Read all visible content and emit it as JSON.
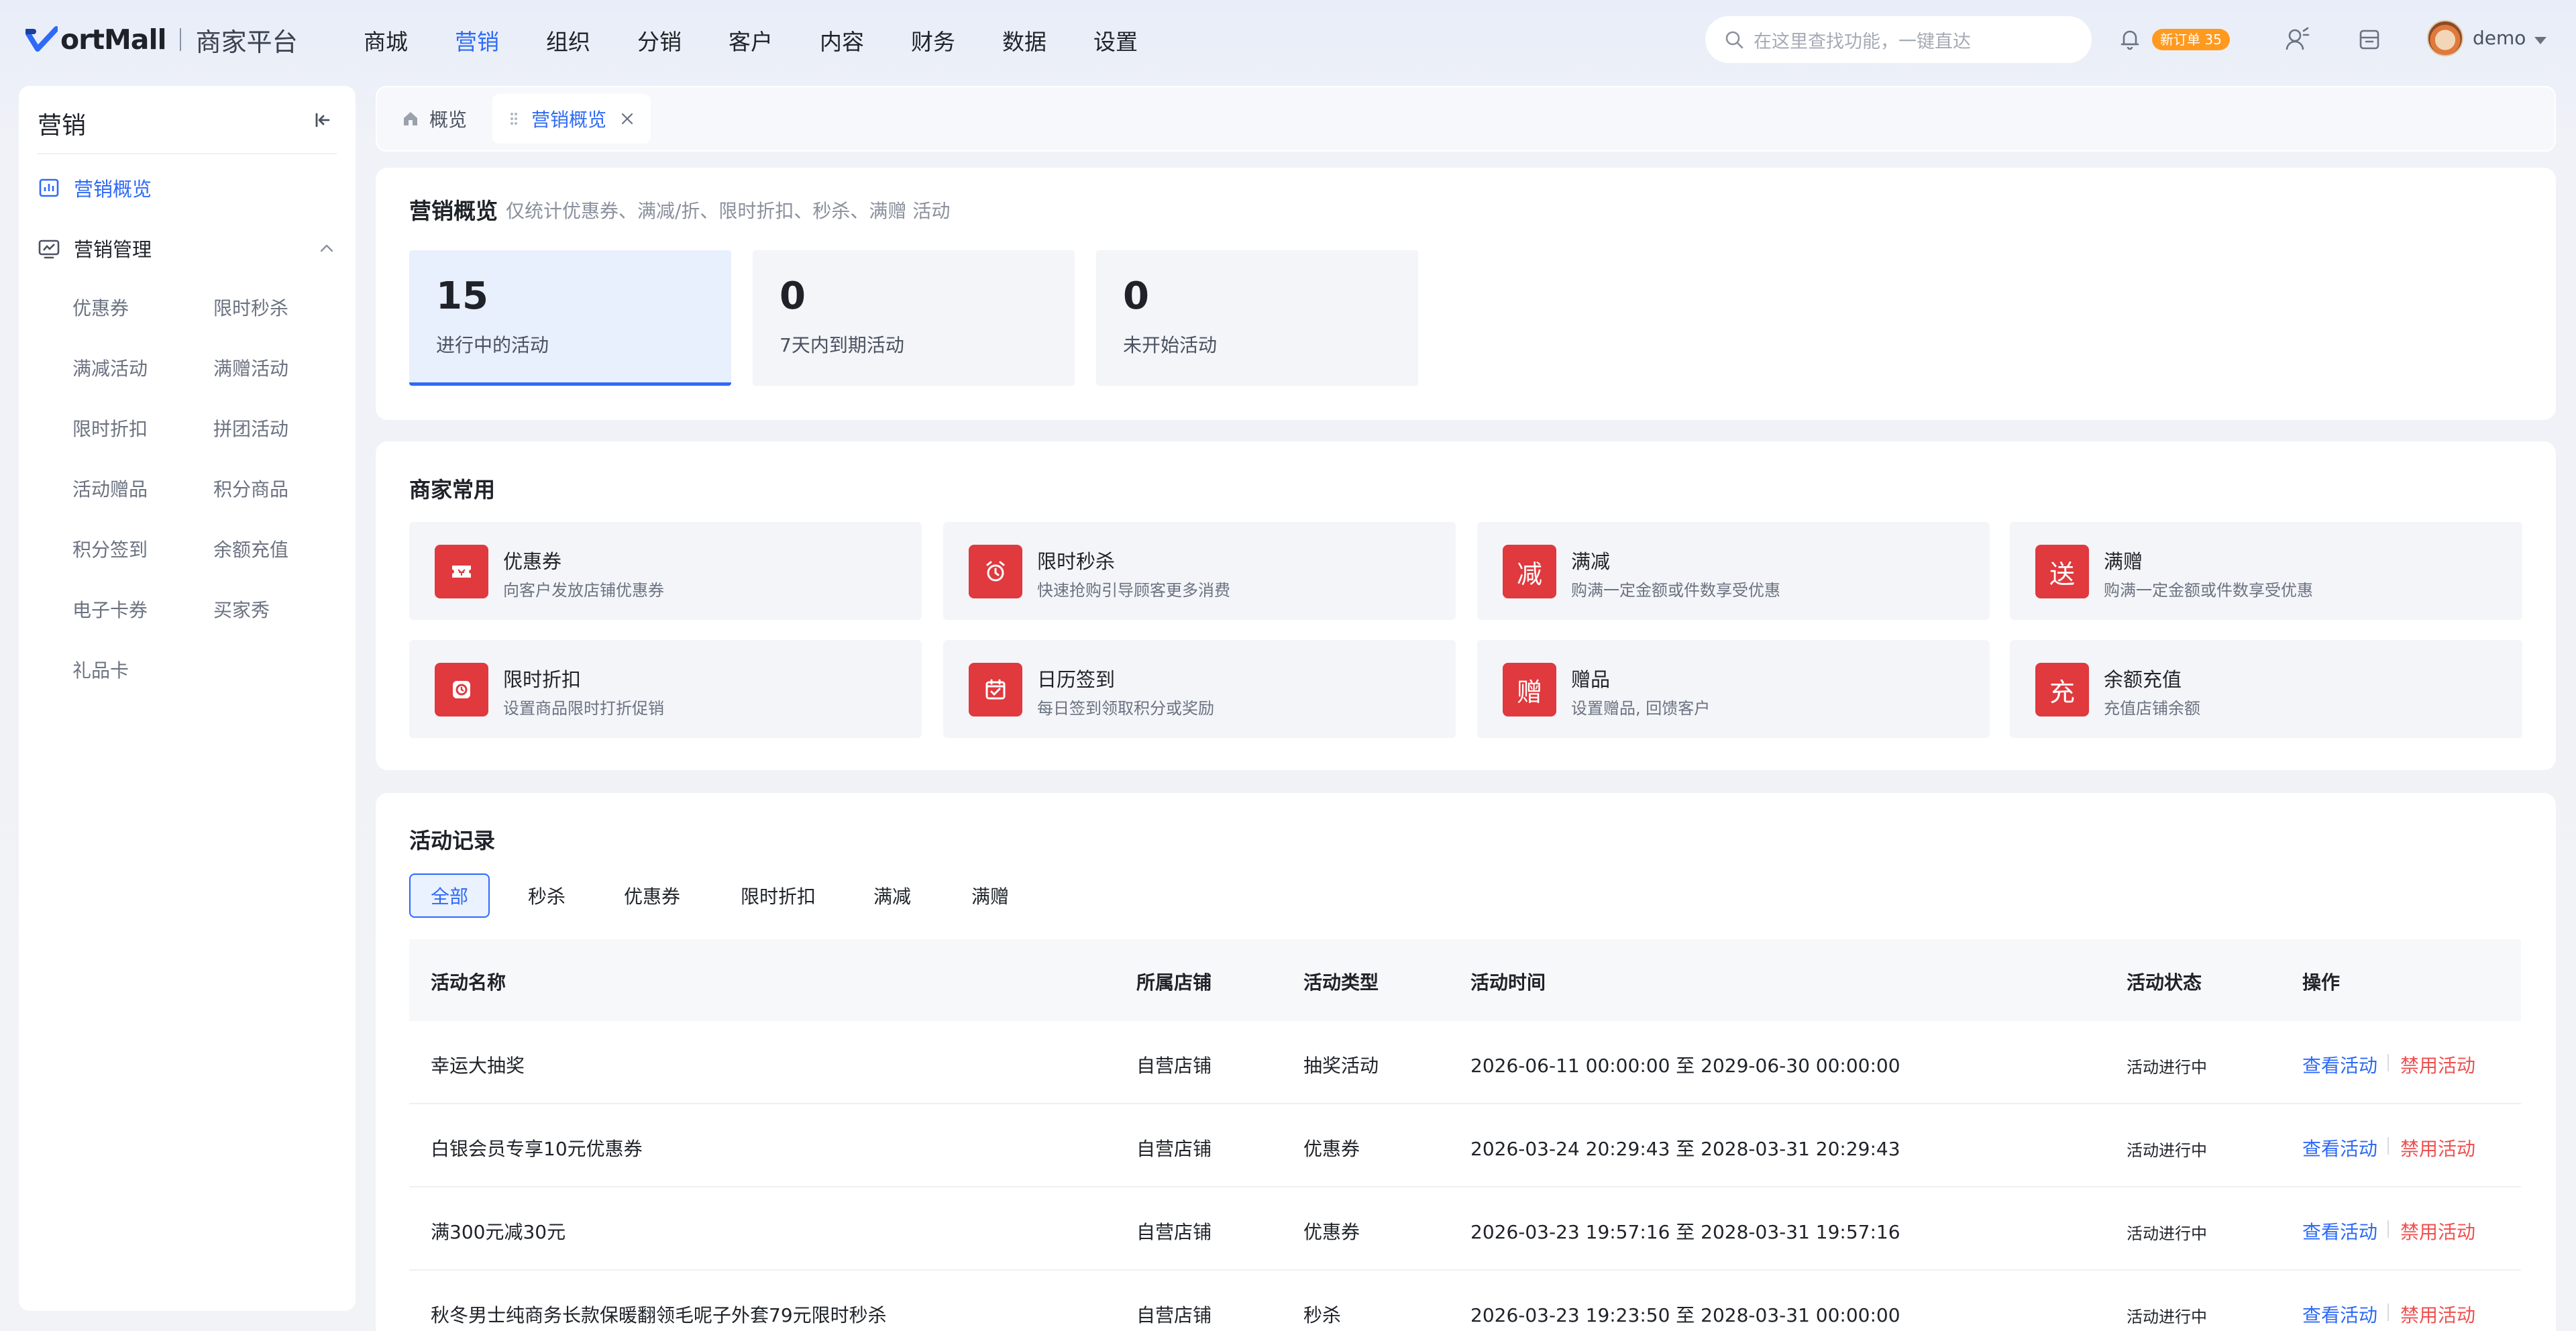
{
  "header": {
    "brand": "ortMall",
    "platform": "商家平台",
    "nav": [
      "商城",
      "营销",
      "组织",
      "分销",
      "客户",
      "内容",
      "财务",
      "数据",
      "设置"
    ],
    "active_nav": "营销",
    "search_placeholder": "在这里查找功能，一键直达",
    "order_badge": "新订单 35",
    "user": "demo",
    "accent": "#2e6af6"
  },
  "sidebar": {
    "title": "营销",
    "overview": "营销概览",
    "group": "营销管理",
    "items": [
      "优惠券",
      "限时秒杀",
      "满减活动",
      "满赠活动",
      "限时折扣",
      "拼团活动",
      "活动赠品",
      "积分商品",
      "积分签到",
      "余额充值",
      "电子卡券",
      "买家秀",
      "礼品卡"
    ]
  },
  "tabs": [
    {
      "label": "概览"
    },
    {
      "label": "营销概览"
    }
  ],
  "overview": {
    "title": "营销概览",
    "subtitle": "仅统计优惠券、满减/折、限时折扣、秒杀、满赠 活动",
    "stats": [
      {
        "value": "15",
        "label": "进行中的活动"
      },
      {
        "value": "0",
        "label": "7天内到期活动"
      },
      {
        "value": "0",
        "label": "未开始活动"
      }
    ]
  },
  "common": {
    "title": "商家常用",
    "tiles": [
      {
        "icon": "ticket-icon",
        "title": "优惠券",
        "desc": "向客户发放店铺优惠券"
      },
      {
        "icon": "alarm-clock-icon",
        "title": "限时秒杀",
        "desc": "快速抢购引导顾客更多消费"
      },
      {
        "icon": "jian-char-icon",
        "glyph": "减",
        "title": "满减",
        "desc": "购满一定金额或件数享受优惠"
      },
      {
        "icon": "song-char-icon",
        "glyph": "送",
        "title": "满赠",
        "desc": "购满一定金额或件数享受优惠"
      },
      {
        "icon": "timer-icon",
        "title": "限时折扣",
        "desc": "设置商品限时打折促销"
      },
      {
        "icon": "calendar-check-icon",
        "title": "日历签到",
        "desc": "每日签到领取积分或奖励"
      },
      {
        "icon": "zeng-char-icon",
        "glyph": "赠",
        "title": "赠品",
        "desc": "设置赠品, 回馈客户"
      },
      {
        "icon": "chong-char-icon",
        "glyph": "充",
        "title": "余额充值",
        "desc": "充值店铺余额"
      }
    ]
  },
  "records": {
    "title": "活动记录",
    "filters": [
      "全部",
      "秒杀",
      "优惠券",
      "限时折扣",
      "满减",
      "满赠"
    ],
    "columns": [
      "活动名称",
      "所属店铺",
      "活动类型",
      "活动时间",
      "活动状态",
      "操作"
    ],
    "rows": [
      {
        "name": "幸运大抽奖",
        "shop": "自营店铺",
        "type": "抽奖活动",
        "time": "2026-06-11 00:00:00 至 2029-06-30 00:00:00",
        "status": "活动进行中",
        "view": "查看活动",
        "disable": "禁用活动"
      },
      {
        "name": "白银会员专享10元优惠券",
        "shop": "自营店铺",
        "type": "优惠券",
        "time": "2026-03-24 20:29:43 至 2028-03-31 20:29:43",
        "status": "活动进行中",
        "view": "查看活动",
        "disable": "禁用活动"
      },
      {
        "name": "满300元减30元",
        "shop": "自营店铺",
        "type": "优惠券",
        "time": "2026-03-23 19:57:16 至 2028-03-31 19:57:16",
        "status": "活动进行中",
        "view": "查看活动",
        "disable": "禁用活动"
      },
      {
        "name": "秋冬男士纯商务长款保暖翻领毛呢子外套79元限时秒杀",
        "shop": "自营店铺",
        "type": "秒杀",
        "time": "2026-03-23 19:23:50 至 2028-03-31 00:00:00",
        "status": "活动进行中",
        "view": "查看活动",
        "disable": "禁用活动"
      }
    ]
  }
}
